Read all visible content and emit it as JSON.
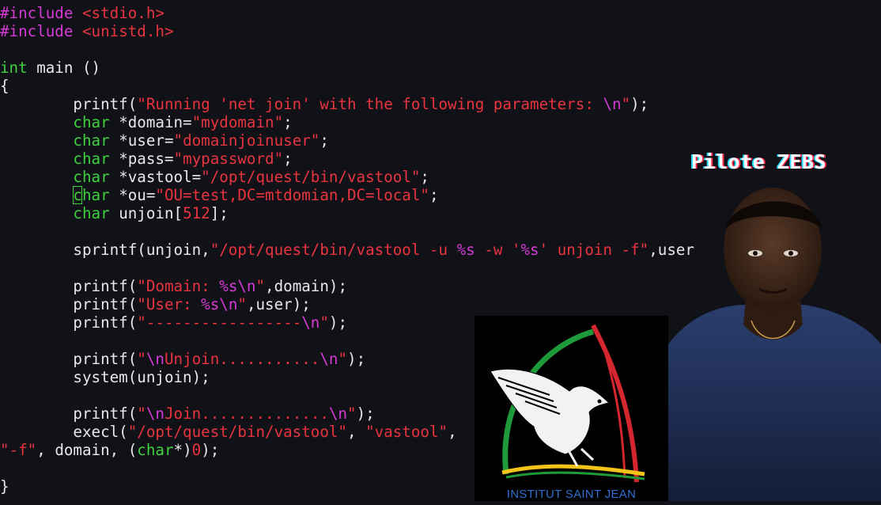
{
  "code": {
    "include_stdio": "#include",
    "hdr_stdio": "<stdio.h>",
    "include_unistd": "#include",
    "hdr_unistd": "<unistd.h>",
    "int_kw": "int",
    "main_sig": " main ()",
    "open_brace": "{",
    "close_brace": "}",
    "printf_kw": "printf(",
    "running_str": "\"Running 'net join' with the following parameters: ",
    "nl": "\\n",
    "quote_close": "\"",
    "paren_semi": ");",
    "char_kw": "char",
    "domain_decl": " *domain=",
    "domain_val": "\"mydomain\"",
    "user_decl": " *user=",
    "user_val": "\"domainjoinuser\"",
    "pass_decl": " *pass=",
    "pass_val": "\"mypassword\"",
    "vastool_decl": " *vastool=",
    "vastool_val": "\"/opt/quest/bin/vastool\"",
    "cursor_char": "c",
    "har_rest": "har",
    "ou_decl": " *ou=",
    "ou_val": "\"OU=test,DC=mtdomian,DC=local\"",
    "unjoin_decl": " unjoin[",
    "unjoin_size": "512",
    "unjoin_end": "];",
    "semi": ";",
    "sprintf_call": "sprintf(unjoin,",
    "sprintf_str_a": "\"/opt/quest/bin/vastool -u ",
    "fmt_s": "%s",
    "sprintf_str_b": " -w '",
    "sprintf_str_c": "' unjoin -f\"",
    "sprintf_tail": ",user",
    "domain_str_a": "\"Domain: ",
    "domain_tail": ",domain);",
    "user_str_a": "\"User: ",
    "user_tail": ",user);",
    "dashes_str": "\"-----------------",
    "unjoin_str": "Unjoin...........",
    "system_call": "system(unjoin);",
    "join_str": "Join..............",
    "execl_call": "execl(",
    "execl_path": "\"/opt/quest/bin/vastool\"",
    "comma_sp": ", ",
    "execl_name": "\"vastool\"",
    "execl_comma": ",",
    "f_str": "\"-f\"",
    "last_mid": ", domain, (",
    "last_char": "char",
    "last_ptr": "*)",
    "zero": "0",
    "last_end": ");",
    "quote_open": "\""
  },
  "logo": {
    "caption": "INSTITUT SAINT JEAN",
    "colors": {
      "green": "#1e9a3a",
      "red": "#d4262e",
      "yellow": "#f2c318"
    }
  },
  "badge": {
    "text": "Pilote ZEBS"
  },
  "colors": {
    "background": "#111118",
    "preprocessor": "#d63ad6",
    "string": "#e8343f",
    "type": "#3fd13f",
    "plain": "#e8e8e8"
  }
}
